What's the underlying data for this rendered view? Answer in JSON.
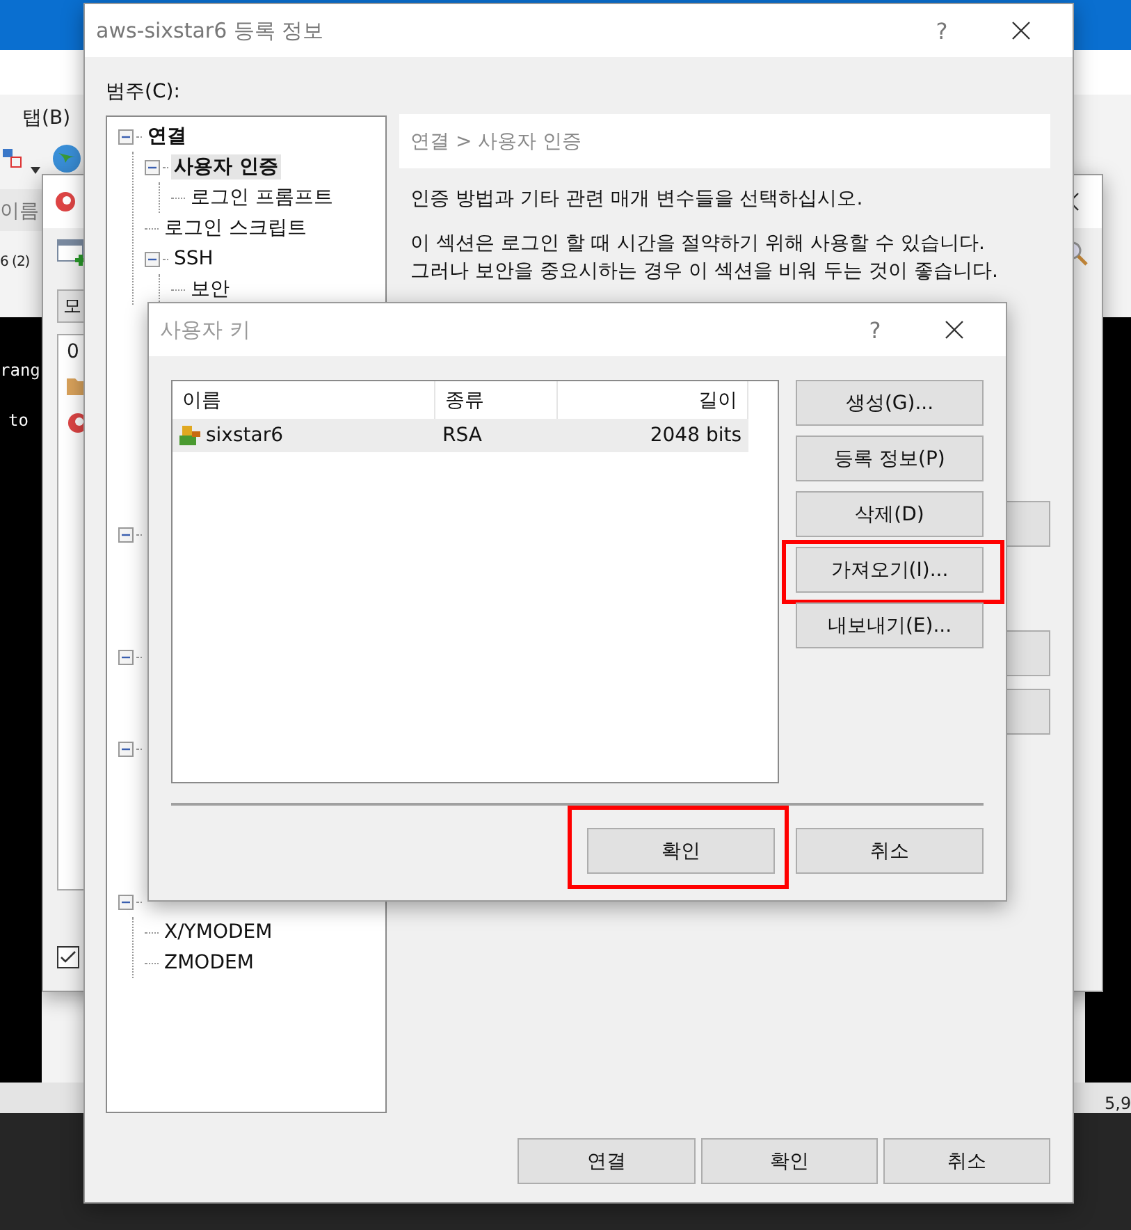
{
  "background_app": {
    "menu_item": "탭(B)",
    "column_label": "이름",
    "tab_label": "6 (2)",
    "terminal_lines": [
      "rang",
      "to"
    ],
    "status_text": "5,9"
  },
  "session_window": {
    "filter_button": "모",
    "list_items": [
      {
        "kind": "text",
        "label": "0"
      },
      {
        "kind": "folder"
      },
      {
        "kind": "session"
      }
    ],
    "startup_checked": true
  },
  "dialog": {
    "title": "aws-sixstar6 등록 정보",
    "help": "?",
    "category_label": "범주(C):",
    "tree": [
      {
        "label": "연결",
        "bold": true,
        "expanded": true,
        "selected": false,
        "children": [
          {
            "label": "사용자 인증",
            "bold": true,
            "expanded": true,
            "selected": true,
            "children": [
              {
                "label": "로그인 프롬프트",
                "selected": false
              }
            ]
          },
          {
            "label": "로그인 스크립트",
            "selected": false
          },
          {
            "label": "SSH",
            "expanded": true,
            "selected": false,
            "children": [
              {
                "label": "보안",
                "selected": false
              }
            ]
          }
        ]
      },
      {
        "expanded": true
      },
      {
        "expanded": true
      },
      {
        "expanded": true
      },
      {
        "expanded": true,
        "children": [
          {
            "label": "X/YMODEM",
            "selected": false
          },
          {
            "label": "ZMODEM",
            "selected": false
          }
        ]
      }
    ],
    "breadcrumb": "연결 > 사용자 인증",
    "description": "인증 방법과 기타 관련 매개 변수들을 선택하십시오.",
    "note_lines": [
      "이 섹션은 로그인 할 때 시간을 절약하기 위해 사용할 수 있습니다.",
      "그러나 보안을 중요시하는 경우 이 섹션을 비워 두는 것이 좋습니다."
    ],
    "buttons": [
      "연결",
      "확인",
      "취소"
    ]
  },
  "user_key_dialog": {
    "title": "사용자 키",
    "help": "?",
    "columns": [
      "이름",
      "종류",
      "길이"
    ],
    "rows": [
      {
        "name": "sixstar6",
        "type": "RSA",
        "length": "2048 bits",
        "selected": true
      }
    ],
    "side_buttons": [
      {
        "label": "생성(G)...",
        "highlighted": false
      },
      {
        "label": "등록 정보(P)",
        "highlighted": false
      },
      {
        "label": "삭제(D)",
        "highlighted": false
      },
      {
        "label": "가져오기(I)...",
        "highlighted": true
      },
      {
        "label": "내보내기(E)...",
        "highlighted": false
      }
    ],
    "buttons": [
      {
        "label": "확인",
        "highlighted": true
      },
      {
        "label": "취소",
        "highlighted": false
      }
    ]
  }
}
